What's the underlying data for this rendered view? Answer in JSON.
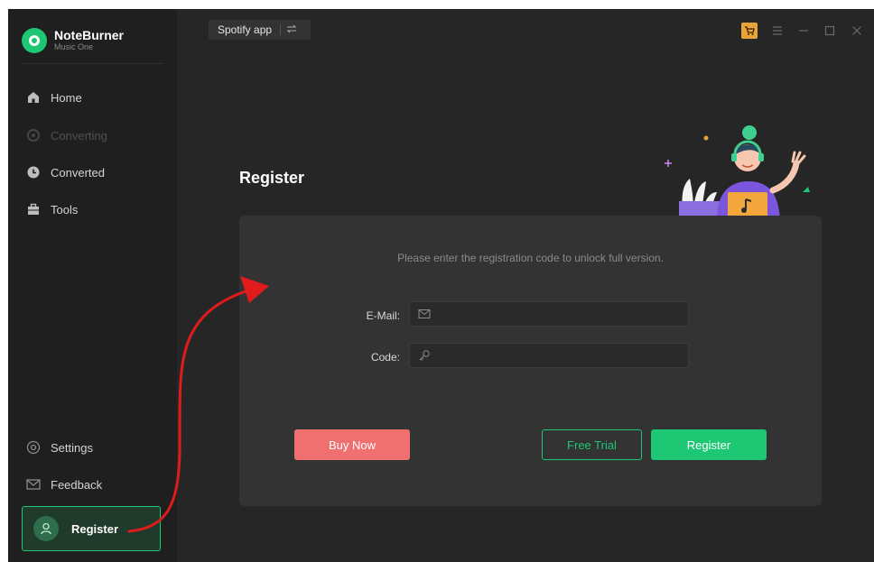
{
  "brand": {
    "name": "NoteBurner",
    "subtitle": "Music One"
  },
  "sidebar": {
    "items": [
      {
        "label": "Home",
        "icon": "home-icon",
        "enabled": true
      },
      {
        "label": "Converting",
        "icon": "converting-icon",
        "enabled": false
      },
      {
        "label": "Converted",
        "icon": "clock-icon",
        "enabled": true
      },
      {
        "label": "Tools",
        "icon": "toolbox-icon",
        "enabled": true
      }
    ],
    "bottom_items": [
      {
        "label": "Settings",
        "icon": "gear-icon"
      },
      {
        "label": "Feedback",
        "icon": "mail-icon"
      }
    ],
    "register_label": "Register"
  },
  "topbar": {
    "source_label": "Spotify app",
    "switch_icon": "swap-icon"
  },
  "window_controls": [
    "cart-icon",
    "menu-icon",
    "minimize-icon",
    "maximize-icon",
    "close-icon"
  ],
  "register_page": {
    "title": "Register",
    "hint": "Please enter the registration code to unlock full version.",
    "email_label": "E-Mail:",
    "email_value": "",
    "email_placeholder": "",
    "code_label": "Code:",
    "code_value": "",
    "code_placeholder": "",
    "buy_now_label": "Buy Now",
    "free_trial_label": "Free Trial",
    "register_label": "Register"
  },
  "colors": {
    "accent": "#1ec773",
    "buy_now": "#f07070",
    "annotation_arrow": "#e01b1b"
  }
}
